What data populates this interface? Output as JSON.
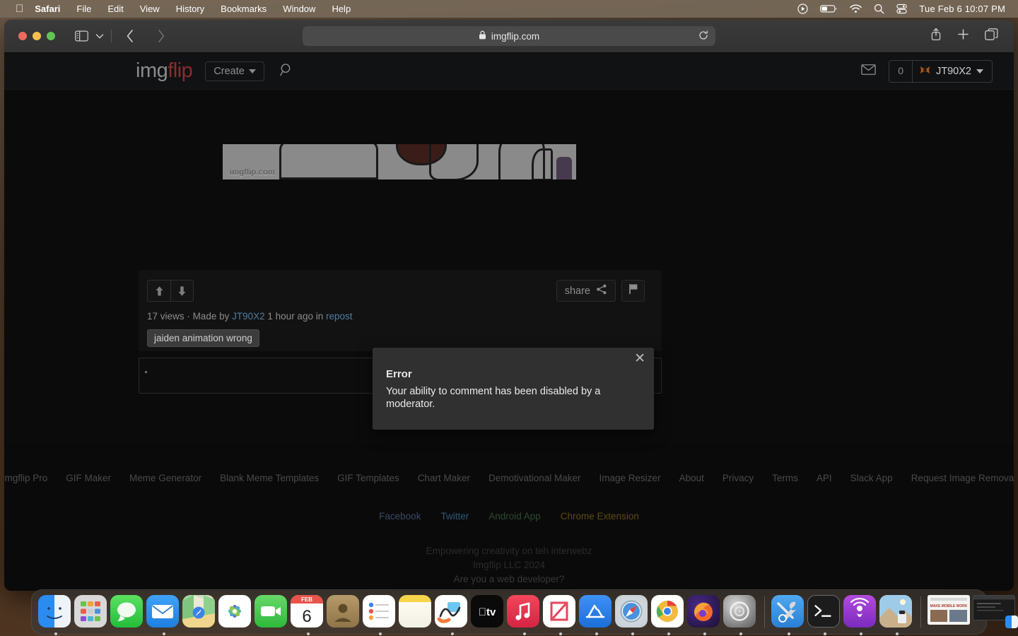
{
  "menubar": {
    "apple_icon": "apple-icon",
    "items": [
      {
        "label": "Safari",
        "bold": true
      },
      {
        "label": "File",
        "bold": false
      },
      {
        "label": "Edit",
        "bold": false
      },
      {
        "label": "View",
        "bold": false
      },
      {
        "label": "History",
        "bold": false
      },
      {
        "label": "Bookmarks",
        "bold": false
      },
      {
        "label": "Window",
        "bold": false
      },
      {
        "label": "Help",
        "bold": false
      }
    ],
    "status_icons": [
      "play-circle-icon",
      "battery-icon",
      "wifi-icon",
      "search-icon",
      "control-center-icon"
    ],
    "clock": "Tue Feb 6  10:07 PM"
  },
  "browser": {
    "traffic_lights": [
      "close-button",
      "minimize-button",
      "zoom-button"
    ],
    "sidebar_icon": "sidebar-icon",
    "tab_overview_caret": "chevron-down-icon",
    "back_icon": "back-chevron-icon",
    "forward_icon": "forward-chevron-icon",
    "url": "imgflip.com",
    "lock_icon": "lock-icon",
    "reload_icon": "reload-icon",
    "right_icons": [
      "share-icon",
      "new-tab-icon",
      "tab-overview-icon"
    ]
  },
  "site_header": {
    "logo_first": "img",
    "logo_second": "flip",
    "create_label": "Create",
    "search_icon": "search-icon",
    "mail_icon": "mail-icon",
    "notification_count": "0",
    "username": "JT90X2",
    "avatar_icon": "user-avatar-icon"
  },
  "meme": {
    "watermark": "imgflip.com"
  },
  "post": {
    "upvote_icon": "arrow-up-icon",
    "downvote_icon": "arrow-down-icon",
    "share_label": "share",
    "share_icon": "share-nodes-icon",
    "flag_icon": "flag-icon",
    "views": "17 views",
    "separator": "·",
    "made_by_prefix": "Made by",
    "author": "JT90X2",
    "time_ago": "1 hour ago in",
    "stream": "repost",
    "tag": "jaiden animation wrong"
  },
  "comment": {
    "value": "",
    "placeholder": ""
  },
  "error_modal": {
    "close_icon": "close-icon",
    "title": "Error",
    "message": "Your ability to comment has been disabled by a moderator."
  },
  "footer": {
    "links": [
      "Imgflip Pro",
      "GIF Maker",
      "Meme Generator",
      "Blank Meme Templates",
      "GIF Templates",
      "Chart Maker",
      "Demotivational Maker",
      "Image Resizer",
      "About",
      "Privacy",
      "Terms",
      "API",
      "Slack App",
      "Request Image Removal"
    ],
    "social": [
      {
        "label": "Facebook",
        "cls": "fb"
      },
      {
        "label": "Twitter",
        "cls": "tw"
      },
      {
        "label": "Android App",
        "cls": "an"
      },
      {
        "label": "Chrome Extension",
        "cls": "cr"
      }
    ],
    "tagline": "Empowering creativity on teh interwebz",
    "copyright": "Imgflip LLC 2024",
    "developer": "Are you a web developer?"
  },
  "dock": {
    "items": [
      {
        "name": "finder",
        "cls": "ic-finder",
        "running": true
      },
      {
        "name": "launchpad",
        "cls": "ic-launchpad",
        "running": false
      },
      {
        "name": "messages",
        "cls": "ic-messages",
        "running": false
      },
      {
        "name": "mail",
        "cls": "ic-mail",
        "running": true
      },
      {
        "name": "maps",
        "cls": "ic-maps",
        "running": false
      },
      {
        "name": "photos",
        "cls": "ic-photos",
        "running": false
      },
      {
        "name": "facetime",
        "cls": "ic-facetime",
        "running": false
      },
      {
        "name": "calendar",
        "cls": "ic-calendar",
        "running": true,
        "month": "FEB",
        "day": "6"
      },
      {
        "name": "contacts",
        "cls": "ic-contacts",
        "running": false
      },
      {
        "name": "reminders",
        "cls": "ic-reminders",
        "running": true
      },
      {
        "name": "notes",
        "cls": "ic-notes",
        "running": false
      },
      {
        "name": "freeform",
        "cls": "ic-freeform",
        "running": true
      },
      {
        "name": "apple-tv",
        "cls": "ic-appletv",
        "running": false
      },
      {
        "name": "music",
        "cls": "ic-music",
        "running": true
      },
      {
        "name": "news",
        "cls": "ic-news",
        "running": true
      },
      {
        "name": "app-store",
        "cls": "ic-appstore",
        "running": true
      },
      {
        "name": "safari",
        "cls": "ic-safari",
        "running": true
      },
      {
        "name": "chrome",
        "cls": "ic-chrome",
        "running": true
      },
      {
        "name": "firefox",
        "cls": "ic-firefox",
        "running": true
      },
      {
        "name": "system-settings",
        "cls": "ic-settings",
        "running": true
      },
      {
        "name": "separator",
        "cls": "sep",
        "running": false
      },
      {
        "name": "utilities",
        "cls": "ic-utility",
        "running": true
      },
      {
        "name": "terminal",
        "cls": "ic-terminal",
        "running": true
      },
      {
        "name": "podcasts",
        "cls": "ic-podcasts",
        "running": true
      },
      {
        "name": "preview",
        "cls": "ic-preview",
        "running": true
      },
      {
        "name": "separator",
        "cls": "sep",
        "running": false
      },
      {
        "name": "minimized-document",
        "cls": "ic-min-doc",
        "running": false
      },
      {
        "name": "minimized-terminal",
        "cls": "ic-min-term",
        "running": false
      },
      {
        "name": "trash",
        "cls": "ic-trash",
        "running": false
      }
    ],
    "apple_tv_label": "tv"
  },
  "colors": {
    "accent_red": "#8c2c2c",
    "link_blue": "#4f7da3",
    "modal_bg": "#303030",
    "page_bg": "#0b0b0b"
  }
}
